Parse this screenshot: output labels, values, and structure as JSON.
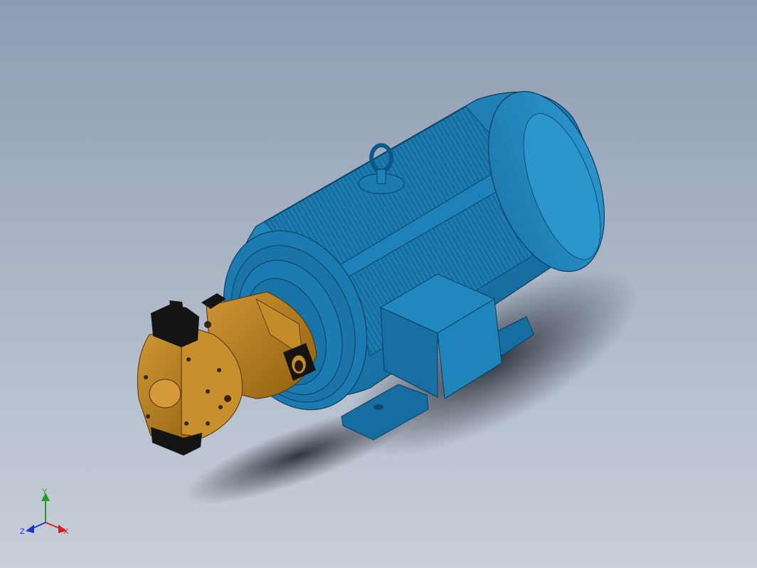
{
  "triad": {
    "y_label": "Y",
    "x_label": "X",
    "z_label": "Z",
    "colors": {
      "x": "#d21f1f",
      "y": "#1fa02b",
      "z": "#2335c4"
    }
  },
  "model": {
    "colors": {
      "motor_body": "#1a7fb4",
      "motor_dark": "#0f5e8c",
      "motor_light": "#3d9fd0",
      "pump_body": "#b87f1c",
      "pump_dark": "#8a5a0e",
      "pump_light": "#d49a3a",
      "black_parts": "#141414",
      "shadow": "#1a1f29"
    }
  }
}
